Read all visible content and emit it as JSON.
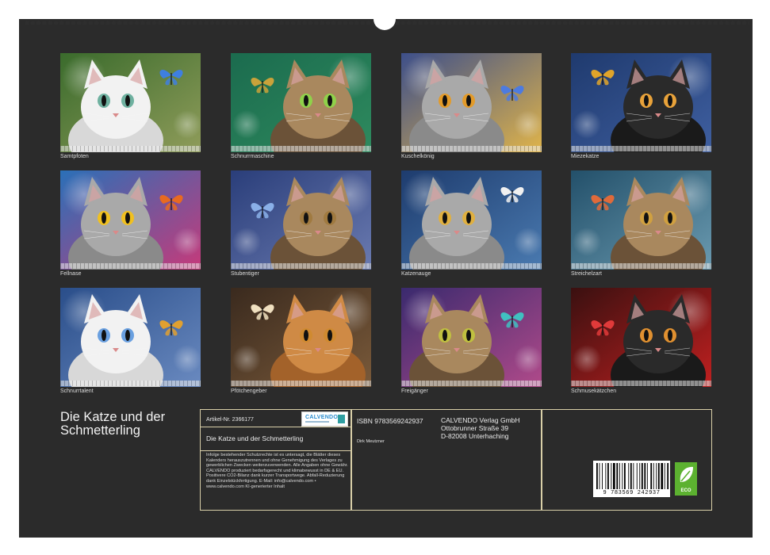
{
  "calendar": {
    "title": "Die Katze und der Schmetterling",
    "months": [
      {
        "caption": "Samtpfoten",
        "cat": "white",
        "bg1": "#3a6b2c",
        "bg2": "#8f9c5a",
        "eye": "#6fb1a0",
        "fly": "#3f7fe0"
      },
      {
        "caption": "Schnurrmaschine",
        "cat": "tabby",
        "bg1": "#1b6b4e",
        "bg2": "#2e8a5e",
        "eye": "#8fd14a",
        "fly": "#c9a23a"
      },
      {
        "caption": "Kuschelkönig",
        "cat": "grey",
        "bg1": "#3d4f8a",
        "bg2": "#e0b44a",
        "eye": "#e39b2a",
        "fly": "#4d7be0"
      },
      {
        "caption": "Miezekatze",
        "cat": "black",
        "bg1": "#1f3a6e",
        "bg2": "#3f5fa0",
        "eye": "#e8a23a",
        "fly": "#e0a42a"
      },
      {
        "caption": "Fellnase",
        "cat": "grey",
        "bg1": "#2a70b8",
        "bg2": "#c63a7a",
        "eye": "#f0c020",
        "fly": "#e86a20"
      },
      {
        "caption": "Stubentiger",
        "cat": "tabby",
        "bg1": "#2a3e7a",
        "bg2": "#6a7ab0",
        "eye": "#a07a40",
        "fly": "#8ab0e8"
      },
      {
        "caption": "Katzenauge",
        "cat": "grey",
        "bg1": "#1e3c6e",
        "bg2": "#4a7ab0",
        "eye": "#e0b040",
        "fly": "#f0f0f0"
      },
      {
        "caption": "Streichelzart",
        "cat": "tabby",
        "bg1": "#23506a",
        "bg2": "#6a9ab0",
        "eye": "#d0a040",
        "fly": "#e06a3a"
      },
      {
        "caption": "Schnurrtalent",
        "cat": "white",
        "bg1": "#2a4e8a",
        "bg2": "#6a8ac0",
        "eye": "#6aa0e0",
        "fly": "#e0a030"
      },
      {
        "caption": "Pfötchengeber",
        "cat": "ginger",
        "bg1": "#3a2a1e",
        "bg2": "#7a5a3a",
        "eye": "#d08a30",
        "fly": "#f0e0c0"
      },
      {
        "caption": "Freigänger",
        "cat": "tabby",
        "bg1": "#3a2a6e",
        "bg2": "#b04a8a",
        "eye": "#c0c040",
        "fly": "#40c0c0"
      },
      {
        "caption": "Schmusekätzchen",
        "cat": "black",
        "bg1": "#3a1010",
        "bg2": "#c02020",
        "eye": "#e09030",
        "fly": "#e03a3a"
      }
    ]
  },
  "info": {
    "article_label": "Artikel-Nr. 2366177",
    "product_title": "Die Katze und der Schmetterling",
    "isbn": "ISBN 9783569242937",
    "author": "Dirk Meutzner",
    "publisher": {
      "name": "CALVENDO Verlag GmbH",
      "street": "Ottobrunner Straße 39",
      "city": "D-82008 Unterhaching"
    },
    "legal_text": "Infolge bestehender Schutzrechte ist es untersagt, die Blätter dieses Kalenders herauszutrennen und ohne Genehmigung des Verlages zu gewerblichen Zwecken weiterzuverwenden. Alle Angaben ohne Gewähr. CALVENDO produziert bedarfsgerecht und klimabewusst in DE & EU. Positivere CO2-Bilanz dank kurzer Transportwege. Abfall-Reduzierung dank Einzelstückfertigung. E-Mail: info@calvendo.com • www.calvendo.com KI-generierter Inhalt",
    "logo_text": "CALVENDO",
    "barcode_number": "9 783569 242937",
    "eco_label": "ECO"
  }
}
